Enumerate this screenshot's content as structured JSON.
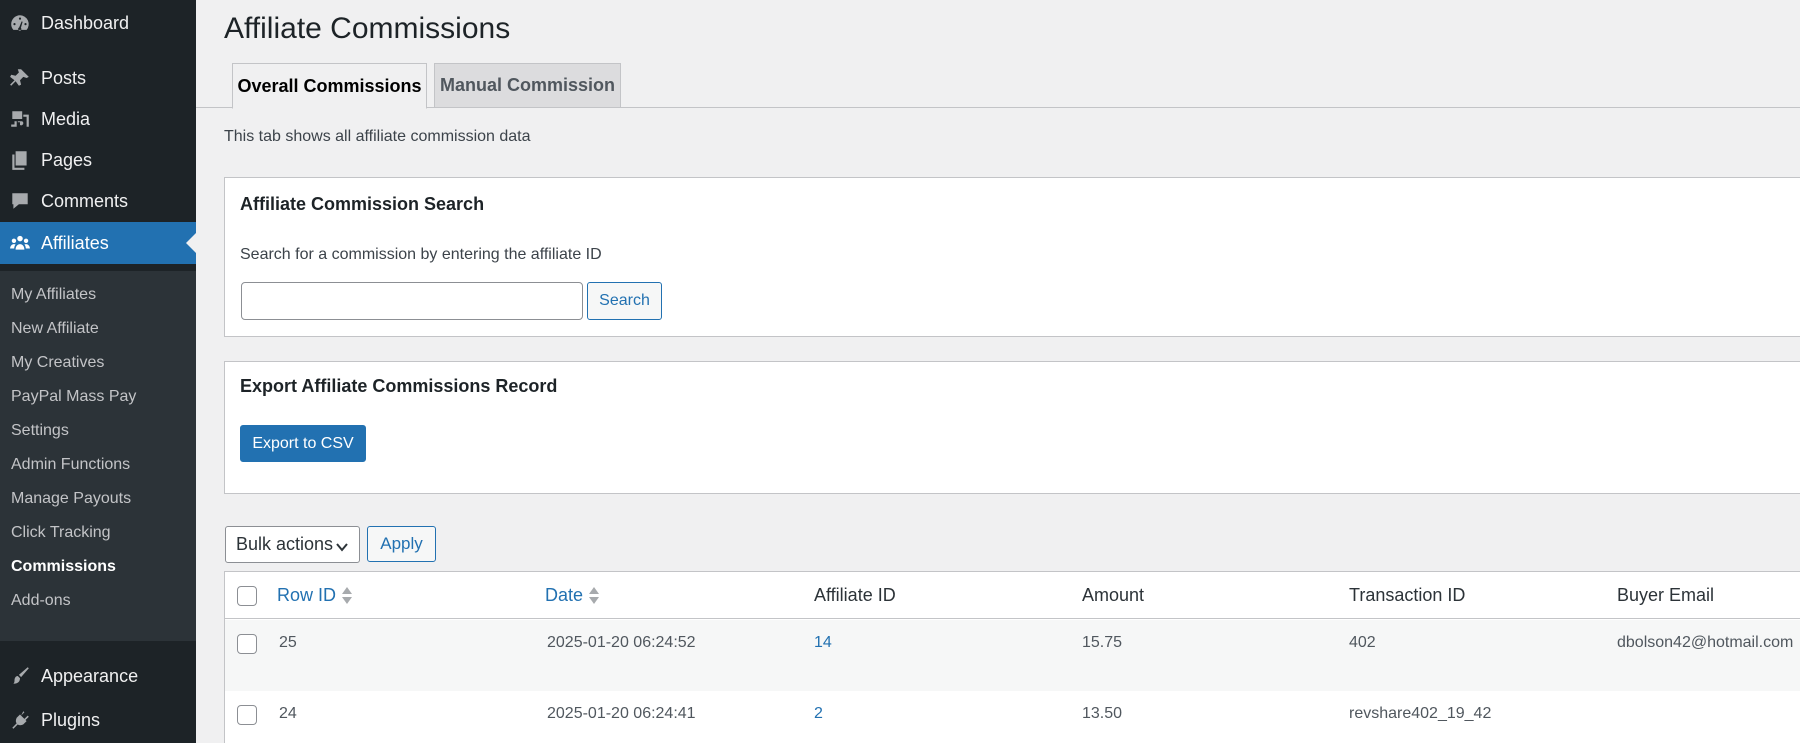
{
  "sidebar": {
    "top_items": [
      {
        "label": "Dashboard",
        "icon": "dashboard-icon"
      },
      {
        "label": "Posts",
        "icon": "pin-icon"
      },
      {
        "label": "Media",
        "icon": "media-icon"
      },
      {
        "label": "Pages",
        "icon": "pages-icon"
      },
      {
        "label": "Comments",
        "icon": "comment-icon"
      },
      {
        "label": "Affiliates",
        "icon": "groups-icon",
        "active": true
      }
    ],
    "submenu": [
      "My Affiliates",
      "New Affiliate",
      "My Creatives",
      "PayPal Mass Pay",
      "Settings",
      "Admin Functions",
      "Manage Payouts",
      "Click Tracking",
      "Commissions",
      "Add-ons"
    ],
    "current_submenu": "Commissions",
    "bottom_items": [
      {
        "label": "Appearance",
        "icon": "brush-icon"
      },
      {
        "label": "Plugins",
        "icon": "plugin-icon"
      }
    ]
  },
  "page": {
    "title": "Affiliate Commissions",
    "tabs": [
      "Overall Commissions",
      "Manual Commission"
    ],
    "active_tab": "Overall Commissions",
    "description": "This tab shows all affiliate commission data"
  },
  "search_box": {
    "title": "Affiliate Commission Search",
    "text": "Search for a commission by entering the affiliate ID",
    "input_value": "",
    "button_label": "Search"
  },
  "export_box": {
    "title": "Export Affiliate Commissions Record",
    "button_label": "Export to CSV"
  },
  "bulk": {
    "selected": "Bulk actions",
    "apply_label": "Apply"
  },
  "table": {
    "columns": [
      "Row ID",
      "Date",
      "Affiliate ID",
      "Amount",
      "Transaction ID",
      "Buyer Email"
    ],
    "rows": [
      {
        "row_id": "25",
        "date": "2025-01-20 06:24:52",
        "affiliate_id": "14",
        "amount": "15.75",
        "transaction_id": "402",
        "buyer_email": "dbolson42@hotmail.com"
      },
      {
        "row_id": "24",
        "date": "2025-01-20 06:24:41",
        "affiliate_id": "2",
        "amount": "13.50",
        "transaction_id": "revshare402_19_42",
        "buyer_email": ""
      }
    ]
  },
  "colors": {
    "sidebar_bg": "#1d2327",
    "submenu_bg": "#2c3338",
    "accent": "#2271b1",
    "page_bg": "#f0f0f1"
  }
}
